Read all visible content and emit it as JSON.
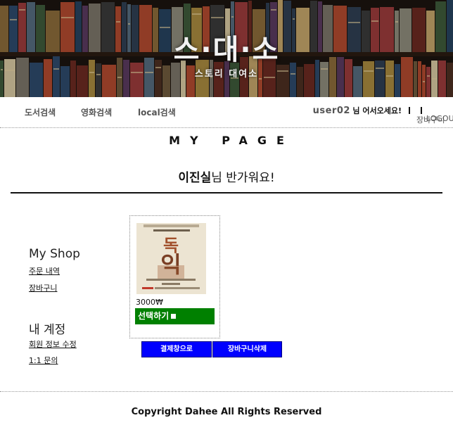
{
  "banner": {
    "logo_main": "스·대·소",
    "logo_sub": "스토리 대여소"
  },
  "nav": {
    "book_search": "도서검색",
    "movie_search": "영화검색",
    "local_search": "local검색"
  },
  "user": {
    "username": "user02",
    "welcome": "님 어서오세요!",
    "cart_link": "장바구니",
    "logout_link": "LOGOUT"
  },
  "page": {
    "title": "MY PAGE",
    "greeting_name": "이진실",
    "greeting_rest": "님 반가워요!"
  },
  "sidebar": {
    "shop_heading": "My Shop",
    "shop_links": [
      "주문 내역",
      "장바구니"
    ],
    "account_heading": "내 계정",
    "account_links": [
      "회원 정보 수정",
      "1:1 문의"
    ]
  },
  "cart_item": {
    "poster_title": "독 익",
    "price": "3000₩",
    "select_label": "선택하기"
  },
  "actions": {
    "pay": "결제창으로",
    "delete_cart": "장바구니삭제"
  },
  "footer": {
    "copyright": "Copyright Dahee All Rights Reserved"
  },
  "colors": {
    "select_button": "#008000",
    "action_button": "#0000ff"
  }
}
